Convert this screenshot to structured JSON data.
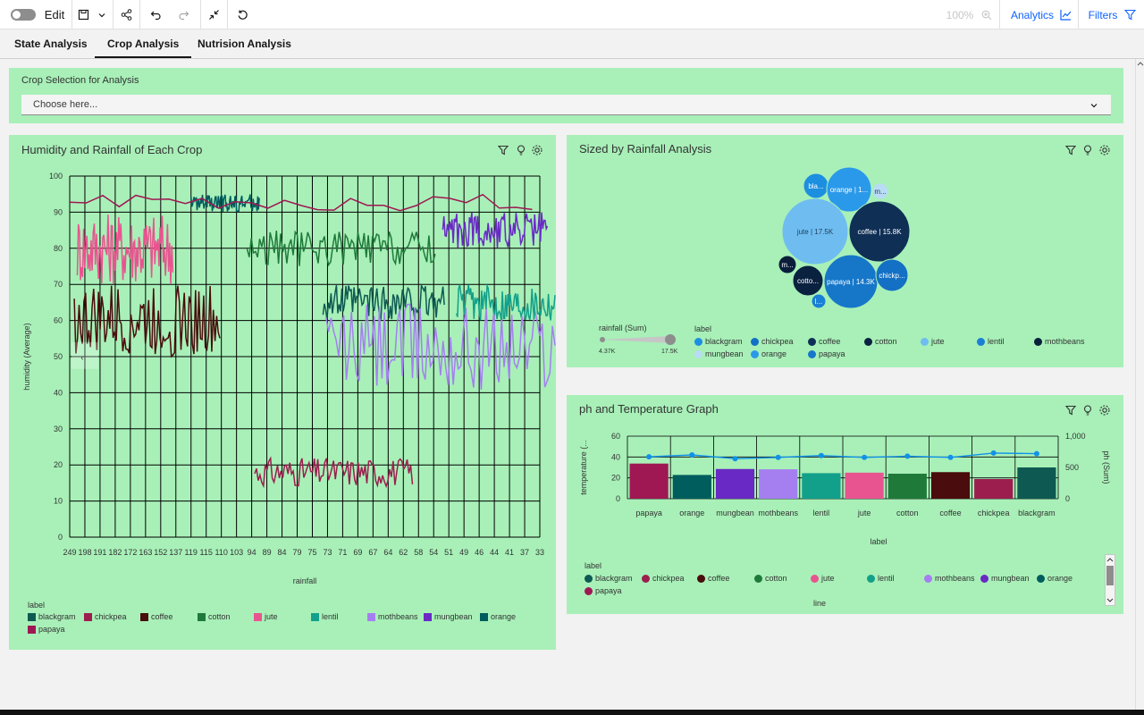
{
  "toolbar": {
    "edit_label": "Edit",
    "zoom": "100%",
    "analytics_label": "Analytics",
    "filters_label": "Filters"
  },
  "tabs": [
    {
      "label": "State Analysis"
    },
    {
      "label": "Crop Analysis",
      "active": true
    },
    {
      "label": "Nutrision Analysis"
    }
  ],
  "crop_selection": {
    "title": "Crop Selection for Analysis",
    "placeholder": "Choose here..."
  },
  "colors": {
    "panel_bg": "#a8f0b8",
    "accent": "#0f62fe"
  },
  "humidity_panel": {
    "title": "Humidity and Rainfall of Each Crop",
    "legend_title": "label",
    "legend": [
      {
        "label": "blackgram",
        "color": "#0e5a52"
      },
      {
        "label": "chickpea",
        "color": "#9b1e4e"
      },
      {
        "label": "coffee",
        "color": "#4a0c0c"
      },
      {
        "label": "cotton",
        "color": "#1f7a3a"
      },
      {
        "label": "jute",
        "color": "#e8548f"
      },
      {
        "label": "lentil",
        "color": "#12a08a"
      },
      {
        "label": "mothbeans",
        "color": "#a57ff0"
      },
      {
        "label": "mungbean",
        "color": "#6929c4"
      },
      {
        "label": "orange",
        "color": "#005d5d"
      },
      {
        "label": "papaya",
        "color": "#9f1853"
      }
    ]
  },
  "bubble_panel": {
    "title": "Sized by Rainfall Analysis",
    "size_legend_title": "rainfall (Sum)",
    "size_min": "4.37K",
    "size_max": "17.5K",
    "legend_title": "label",
    "legend": [
      {
        "label": "blackgram",
        "color": "#1d8fe0"
      },
      {
        "label": "chickpea",
        "color": "#1370c4"
      },
      {
        "label": "coffee",
        "color": "#0f2f55"
      },
      {
        "label": "cotton",
        "color": "#0b2140"
      },
      {
        "label": "jute",
        "color": "#6fbdf0"
      },
      {
        "label": "lentil",
        "color": "#1a7fd6"
      },
      {
        "label": "mothbeans",
        "color": "#0a1e3a"
      },
      {
        "label": "mungbean",
        "color": "#b9dcf5"
      },
      {
        "label": "orange",
        "color": "#2a99ea"
      },
      {
        "label": "papaya",
        "color": "#1677c9"
      }
    ],
    "bubble_labels": [
      "bla...",
      "orange | 1...",
      "m...",
      "jute | 17.5K",
      "coffee | 15.8K",
      "m...",
      "cotto...",
      "papaya | 14.3K",
      "chickp...",
      "l..."
    ]
  },
  "ph_panel": {
    "title": "ph and Temperature Graph",
    "y_left_label": "temperature (...",
    "y_right_label": "ph (Sum)",
    "x_label": "label",
    "legend_title": "label",
    "legend_footer": "line",
    "legend": [
      {
        "label": "blackgram",
        "color": "#0e5a52"
      },
      {
        "label": "chickpea",
        "color": "#9b1e4e"
      },
      {
        "label": "coffee",
        "color": "#4a0c0c"
      },
      {
        "label": "cotton",
        "color": "#1f7a3a"
      },
      {
        "label": "jute",
        "color": "#e8548f"
      },
      {
        "label": "lentil",
        "color": "#12a08a"
      },
      {
        "label": "mothbeans",
        "color": "#a57ff0"
      },
      {
        "label": "mungbean",
        "color": "#6929c4"
      },
      {
        "label": "orange",
        "color": "#005d5d"
      },
      {
        "label": "papaya",
        "color": "#9f1853"
      }
    ]
  },
  "chart_data": [
    {
      "type": "line",
      "title": "Humidity and Rainfall of Each Crop",
      "xlabel": "rainfall",
      "ylabel": "humidity (Average)",
      "ylim": [
        0,
        100
      ],
      "yticks": [
        0,
        10,
        20,
        30,
        40,
        50,
        60,
        70,
        80,
        90,
        100
      ],
      "xtick_labels": [
        "249",
        "198",
        "191",
        "182",
        "172",
        "163",
        "152",
        "137",
        "119",
        "115",
        "110",
        "103",
        "94",
        "89",
        "84",
        "79",
        "75",
        "73",
        "71",
        "69",
        "67",
        "64",
        "62",
        "58",
        "54",
        "51",
        "49",
        "46",
        "44",
        "41",
        "37",
        "33"
      ],
      "grid": true,
      "legend_position": "bottom",
      "series": [
        {
          "name": "chickpea",
          "humidity_range": [
            14,
            22
          ]
        },
        {
          "name": "jute",
          "humidity_range": [
            70,
            90
          ]
        },
        {
          "name": "coffee",
          "humidity_range": [
            50,
            70
          ]
        },
        {
          "name": "cotton",
          "humidity_range": [
            75,
            85
          ]
        },
        {
          "name": "blackgram",
          "humidity_range": [
            60,
            70
          ]
        },
        {
          "name": "mothbeans",
          "humidity_range": [
            40,
            65
          ]
        },
        {
          "name": "mungbean",
          "humidity_range": [
            80,
            90
          ]
        },
        {
          "name": "lentil",
          "humidity_range": [
            60,
            70
          ]
        },
        {
          "name": "orange",
          "humidity_range": [
            90,
            95
          ]
        },
        {
          "name": "papaya",
          "humidity_range": [
            90,
            95
          ]
        }
      ]
    },
    {
      "type": "bar",
      "title": "ph and Temperature Graph",
      "xlabel": "label",
      "categories": [
        "papaya",
        "orange",
        "mungbean",
        "mothbeans",
        "lentil",
        "jute",
        "cotton",
        "coffee",
        "chickpea",
        "blackgram"
      ],
      "series": [
        {
          "name": "temperature",
          "axis": "left",
          "values": [
            33.7,
            22.8,
            28.5,
            28.2,
            24.5,
            25,
            24,
            25.5,
            18.9,
            30
          ]
        },
        {
          "name": "ph (Sum)",
          "axis": "right",
          "type": "line",
          "values": [
            670,
            700,
            640,
            660,
            690,
            660,
            680,
            660,
            730,
            720
          ]
        }
      ],
      "y_left_ticks": [
        0,
        20,
        40,
        60
      ],
      "y_right_ticks": [
        "0",
        "500",
        "1,000"
      ]
    }
  ]
}
